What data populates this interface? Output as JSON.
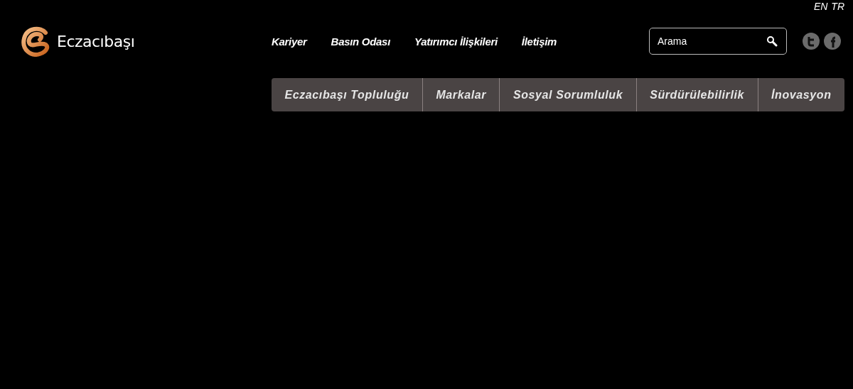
{
  "languages": [
    {
      "label": "EN"
    },
    {
      "label": "TR"
    }
  ],
  "logo": {
    "text": "Eczacıbaşı"
  },
  "top_links": [
    "Kariyer",
    "Basın Odası",
    "Yatırımcı İlişkileri",
    "İletişim"
  ],
  "search": {
    "placeholder": "Arama"
  },
  "main_nav": [
    "Eczacıbaşı Topluluğu",
    "Markalar",
    "Sosyal Sorumluluk",
    "Sürdürülebilirlik",
    "İnovasyon"
  ]
}
